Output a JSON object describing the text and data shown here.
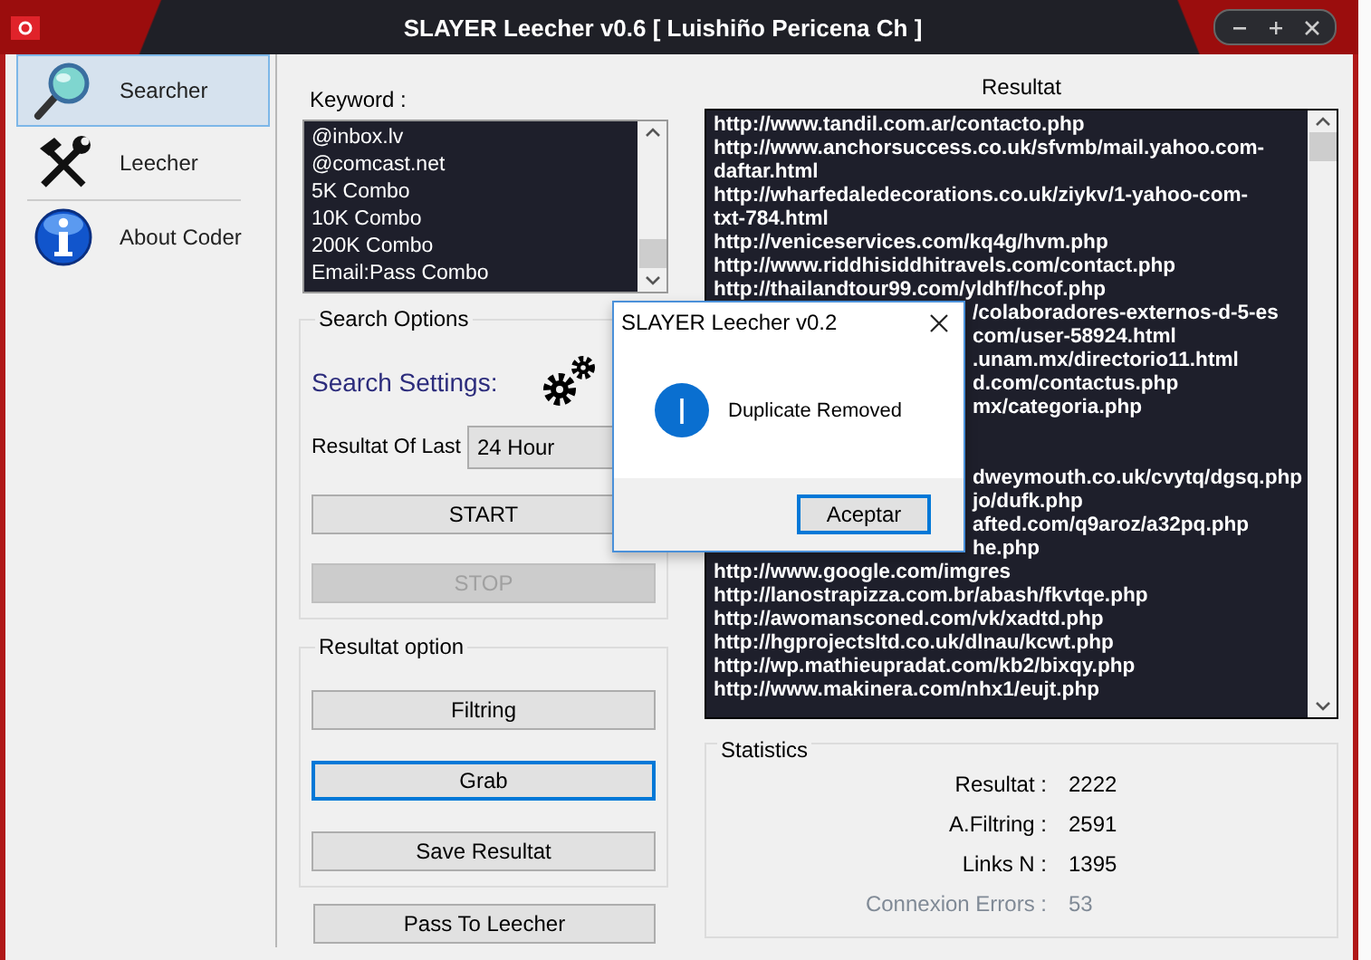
{
  "window": {
    "title": "SLAYER Leecher v0.6 [ Luishiño Pericena Ch ]"
  },
  "nav": [
    {
      "label": "Searcher",
      "selected": true
    },
    {
      "label": "Leecher",
      "selected": false
    },
    {
      "label": "About Coder",
      "selected": false
    }
  ],
  "keyword": {
    "label": "Keyword :",
    "items": [
      "@inbox.lv",
      "@comcast.net",
      "5K Combo",
      "10K Combo",
      "200K Combo",
      "Email:Pass Combo"
    ]
  },
  "search_options": {
    "title": "Search Options",
    "settings_label": "Search Settings:",
    "period_label": "Resultat Of Last",
    "period_value": "24 Hour",
    "buttons": [
      {
        "label": "START",
        "disabled": false
      },
      {
        "label": "STOP",
        "disabled": true
      }
    ]
  },
  "resultat_option": {
    "title": "Resultat option",
    "buttons": [
      {
        "label": "Filtring",
        "focused": false
      },
      {
        "label": "Grab",
        "focused": true
      },
      {
        "label": "Save Resultat",
        "focused": false
      }
    ]
  },
  "pass_button": {
    "label": "Pass To Leecher"
  },
  "results": {
    "title": "Resultat",
    "blocks": [
      {
        "kind": "open",
        "lines": [
          "http://www.tandil.com.ar/contacto.php",
          "http://www.anchorsuccess.co.uk/sfvmb/mail.yahoo.com-",
          "daftar.html",
          "http://wharfedaledecorations.co.uk/ziykv/1-yahoo-com-",
          "txt-784.html",
          "http://veniceservices.com/kq4g/hvm.php",
          "http://www.riddhisiddhitravels.com/contact.php",
          "http://thailandtour99.com/yldhf/hcof.php"
        ]
      },
      {
        "kind": "beside_dialog",
        "lines": [
          "/colaboradores-externos-d-5-es",
          "com/user-58924.html",
          ".unam.mx/directorio11.html",
          "d.com/contactus.php",
          "mx/categoria.php"
        ]
      },
      {
        "kind": "beside_dialog",
        "lines": [
          "dweymouth.co.uk/cvytq/dgsq.php",
          "jo/dufk.php",
          "afted.com/q9aroz/a32pq.php",
          "he.php"
        ]
      },
      {
        "kind": "open",
        "lines": [
          "http://www.google.com/imgres",
          "http://lanostrapizza.com.br/abash/fkvtqe.php",
          "http://awomansconed.com/vk/xadtd.php",
          "http://hgprojectsltd.co.uk/dlnau/kcwt.php",
          "http://wp.mathieupradat.com/kb2/bixqy.php",
          "http://www.makinera.com/nhx1/eujt.php"
        ]
      }
    ]
  },
  "statistics": {
    "title": "Statistics",
    "rows": [
      {
        "label": "Resultat :",
        "value": "2222",
        "disabled": false
      },
      {
        "label": "A.Filtring :",
        "value": "2591",
        "disabled": false
      },
      {
        "label": "Links N :",
        "value": "1395",
        "disabled": false
      },
      {
        "label": "Connexion Errors :",
        "value": "53",
        "disabled": true
      }
    ]
  },
  "dialog": {
    "title": "SLAYER Leecher v0.2",
    "message": "Duplicate Removed",
    "button": {
      "label": "Aceptar",
      "focused": true
    }
  }
}
